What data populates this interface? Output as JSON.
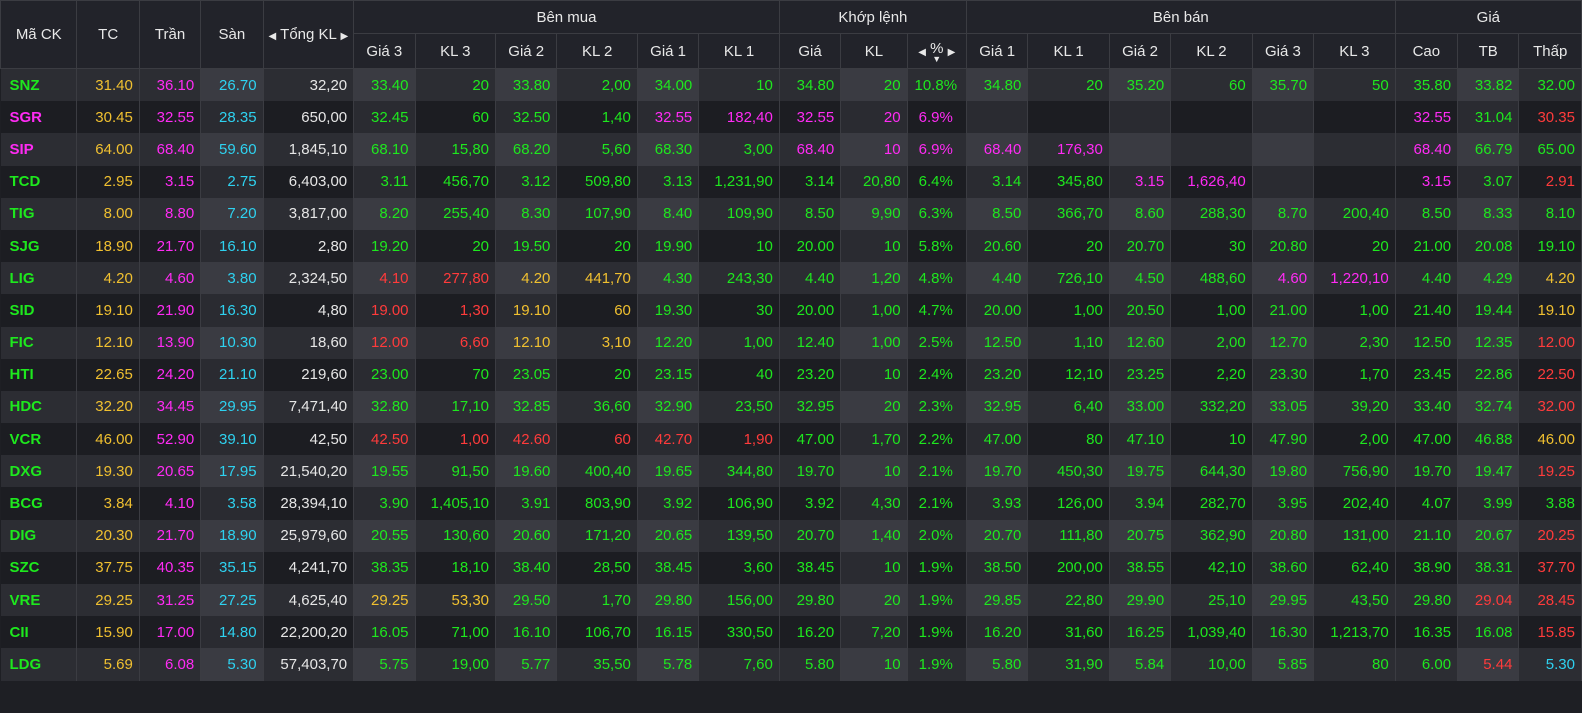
{
  "header": {
    "ma_ck": "Mã CK",
    "tc": "TC",
    "tran": "Trần",
    "san": "Sàn",
    "tong_kl": "Tổng KL",
    "ben_mua": "Bên mua",
    "khop_lenh": "Khớp lệnh",
    "ben_ban": "Bên bán",
    "gia": "Giá",
    "buy_cols": [
      "Giá 3",
      "KL 3",
      "Giá 2",
      "KL 2",
      "Giá 1",
      "KL 1"
    ],
    "match_cols": [
      "Giá",
      "KL",
      "%"
    ],
    "sell_cols": [
      "Giá 1",
      "KL 1",
      "Giá 2",
      "KL 2",
      "Giá 3",
      "KL 3"
    ],
    "price_cols": [
      "Cao",
      "TB",
      "Thấp"
    ]
  },
  "icons": {
    "left": "triangle-left-icon",
    "right": "triangle-right-icon",
    "sort": "sort-down-icon"
  },
  "colors": {
    "ceiling": "#ff2bf4",
    "floor": "#2ed2f0",
    "ref": "#f0c030",
    "up": "#1ee81e",
    "down": "#ff3b3b"
  },
  "rows": [
    {
      "sym": "SNZ",
      "c": "g",
      "v": [
        "31.40",
        "36.10",
        "26.70",
        "32,20",
        "33.40",
        "20",
        "33.80",
        "2,00",
        "34.00",
        "10",
        "34.80",
        "20",
        "10.8%",
        "34.80",
        "20",
        "35.20",
        "60",
        "35.70",
        "50",
        "35.80",
        "33.82",
        "32.00"
      ],
      "k": "yp c w g g g g g g g g g g g g g g g g g g"
    },
    {
      "sym": "SGR",
      "c": "p",
      "v": [
        "30.45",
        "32.55",
        "28.35",
        "650,00",
        "32.45",
        "60",
        "32.50",
        "1,40",
        "32.55",
        "182,40",
        "32.55",
        "20",
        "6.9%",
        "",
        "",
        "",
        "",
        "",
        "",
        "32.55",
        "31.04",
        "30.35"
      ],
      "k": "yp c w g g g g p p p p p w w w w w w p g r"
    },
    {
      "sym": "SIP",
      "c": "p",
      "v": [
        "64.00",
        "68.40",
        "59.60",
        "1,845,10",
        "68.10",
        "15,80",
        "68.20",
        "5,60",
        "68.30",
        "3,00",
        "68.40",
        "10",
        "6.9%",
        "68.40",
        "176,30",
        "",
        "",
        "",
        "",
        "68.40",
        "66.79",
        "65.00"
      ],
      "k": "yp c w g g g g g g p p p p p w w w w p g g"
    },
    {
      "sym": "TCD",
      "c": "g",
      "v": [
        "2.95",
        "3.15",
        "2.75",
        "6,403,00",
        "3.11",
        "456,70",
        "3.12",
        "509,80",
        "3.13",
        "1,231,90",
        "3.14",
        "20,80",
        "6.4%",
        "3.14",
        "345,80",
        "3.15",
        "1,626,40",
        "",
        "",
        "3.15",
        "3.07",
        "2.91"
      ],
      "k": "yp c w g g g g g g g g g g g p p w w p g r"
    },
    {
      "sym": "TIG",
      "c": "g",
      "v": [
        "8.00",
        "8.80",
        "7.20",
        "3,817,00",
        "8.20",
        "255,40",
        "8.30",
        "107,90",
        "8.40",
        "109,90",
        "8.50",
        "9,90",
        "6.3%",
        "8.50",
        "366,70",
        "8.60",
        "288,30",
        "8.70",
        "200,40",
        "8.50",
        "8.33",
        "8.10"
      ],
      "k": "yp c w g g g g g g g g g g g g g g g g g g"
    },
    {
      "sym": "SJG",
      "c": "g",
      "v": [
        "18.90",
        "21.70",
        "16.10",
        "2,80",
        "19.20",
        "20",
        "19.50",
        "20",
        "19.90",
        "10",
        "20.00",
        "10",
        "5.8%",
        "20.60",
        "20",
        "20.70",
        "30",
        "20.80",
        "20",
        "21.00",
        "20.08",
        "19.10"
      ],
      "k": "yp c w g g g g g g g g g g g g g g g g g g"
    },
    {
      "sym": "LIG",
      "c": "g",
      "v": [
        "4.20",
        "4.60",
        "3.80",
        "2,324,50",
        "4.10",
        "277,80",
        "4.20",
        "441,70",
        "4.30",
        "243,30",
        "4.40",
        "1,20",
        "4.8%",
        "4.40",
        "726,10",
        "4.50",
        "488,60",
        "4.60",
        "1,220,10",
        "4.40",
        "4.29",
        "4.20"
      ],
      "k": "yp c w r r y y g g g g g g g g g p p g g y"
    },
    {
      "sym": "SID",
      "c": "g",
      "v": [
        "19.10",
        "21.90",
        "16.30",
        "4,80",
        "19.00",
        "1,30",
        "19.10",
        "60",
        "19.30",
        "30",
        "20.00",
        "1,00",
        "4.7%",
        "20.00",
        "1,00",
        "20.50",
        "1,00",
        "21.00",
        "1,00",
        "21.40",
        "19.44",
        "19.10"
      ],
      "k": "yp c w r r y y g g g g g g g g g g g g g y"
    },
    {
      "sym": "FIC",
      "c": "g",
      "v": [
        "12.10",
        "13.90",
        "10.30",
        "18,60",
        "12.00",
        "6,60",
        "12.10",
        "3,10",
        "12.20",
        "1,00",
        "12.40",
        "1,00",
        "2.5%",
        "12.50",
        "1,10",
        "12.60",
        "2,00",
        "12.70",
        "2,30",
        "12.50",
        "12.35",
        "12.00"
      ],
      "k": "yp c w r r y y g g g g g g g g g g g g g r"
    },
    {
      "sym": "HTI",
      "c": "g",
      "v": [
        "22.65",
        "24.20",
        "21.10",
        "219,60",
        "23.00",
        "70",
        "23.05",
        "20",
        "23.15",
        "40",
        "23.20",
        "10",
        "2.4%",
        "23.20",
        "12,10",
        "23.25",
        "2,20",
        "23.30",
        "1,70",
        "23.45",
        "22.86",
        "22.50"
      ],
      "k": "yp c w g g g g g g g g g g g g g g g g g r"
    },
    {
      "sym": "HDC",
      "c": "g",
      "v": [
        "32.20",
        "34.45",
        "29.95",
        "7,471,40",
        "32.80",
        "17,10",
        "32.85",
        "36,60",
        "32.90",
        "23,50",
        "32.95",
        "20",
        "2.3%",
        "32.95",
        "6,40",
        "33.00",
        "332,20",
        "33.05",
        "39,20",
        "33.40",
        "32.74",
        "32.00"
      ],
      "k": "yp c w g g g g g g g g g g g g g g g g g r"
    },
    {
      "sym": "VCR",
      "c": "g",
      "v": [
        "46.00",
        "52.90",
        "39.10",
        "42,50",
        "42.50",
        "1,00",
        "42.60",
        "60",
        "42.70",
        "1,90",
        "47.00",
        "1,70",
        "2.2%",
        "47.00",
        "80",
        "47.10",
        "10",
        "47.90",
        "2,00",
        "47.00",
        "46.88",
        "46.00"
      ],
      "k": "yp c w r r r r r r g g g g g g g g g g g y"
    },
    {
      "sym": "DXG",
      "c": "g",
      "v": [
        "19.30",
        "20.65",
        "17.95",
        "21,540,20",
        "19.55",
        "91,50",
        "19.60",
        "400,40",
        "19.65",
        "344,80",
        "19.70",
        "10",
        "2.1%",
        "19.70",
        "450,30",
        "19.75",
        "644,30",
        "19.80",
        "756,90",
        "19.70",
        "19.47",
        "19.25"
      ],
      "k": "yp c w g g g g g g g g g g g g g g g g g r"
    },
    {
      "sym": "BCG",
      "c": "g",
      "v": [
        "3.84",
        "4.10",
        "3.58",
        "28,394,10",
        "3.90",
        "1,405,10",
        "3.91",
        "803,90",
        "3.92",
        "106,90",
        "3.92",
        "4,30",
        "2.1%",
        "3.93",
        "126,00",
        "3.94",
        "282,70",
        "3.95",
        "202,40",
        "4.07",
        "3.99",
        "3.88"
      ],
      "k": "yp c w g g g g g g g g g g g g g g g g g g"
    },
    {
      "sym": "DIG",
      "c": "g",
      "v": [
        "20.30",
        "21.70",
        "18.90",
        "25,979,60",
        "20.55",
        "130,60",
        "20.60",
        "171,20",
        "20.65",
        "139,50",
        "20.70",
        "1,40",
        "2.0%",
        "20.70",
        "111,80",
        "20.75",
        "362,90",
        "20.80",
        "131,00",
        "21.10",
        "20.67",
        "20.25"
      ],
      "k": "yp c w g g g g g g g g g g g g g g g g g r"
    },
    {
      "sym": "SZC",
      "c": "g",
      "v": [
        "37.75",
        "40.35",
        "35.15",
        "4,241,70",
        "38.35",
        "18,10",
        "38.40",
        "28,50",
        "38.45",
        "3,60",
        "38.45",
        "10",
        "1.9%",
        "38.50",
        "200,00",
        "38.55",
        "42,10",
        "38.60",
        "62,40",
        "38.90",
        "38.31",
        "37.70"
      ],
      "k": "yp c w g g g g g g g g g g g g g g g g g r"
    },
    {
      "sym": "VRE",
      "c": "g",
      "v": [
        "29.25",
        "31.25",
        "27.25",
        "4,625,40",
        "29.25",
        "53,30",
        "29.50",
        "1,70",
        "29.80",
        "156,00",
        "29.80",
        "20",
        "1.9%",
        "29.85",
        "22,80",
        "29.90",
        "25,10",
        "29.95",
        "43,50",
        "29.80",
        "29.04",
        "28.45"
      ],
      "k": "yp c w y y g g g g g g g g g g g g g g r r"
    },
    {
      "sym": "CII",
      "c": "g",
      "v": [
        "15.90",
        "17.00",
        "14.80",
        "22,200,20",
        "16.05",
        "71,00",
        "16.10",
        "106,70",
        "16.15",
        "330,50",
        "16.20",
        "7,20",
        "1.9%",
        "16.20",
        "31,60",
        "16.25",
        "1,039,40",
        "16.30",
        "1,213,70",
        "16.35",
        "16.08",
        "15.85"
      ],
      "k": "yp c w g g g g g g g g g g g g g g g g g r"
    },
    {
      "sym": "LDG",
      "c": "g",
      "v": [
        "5.69",
        "6.08",
        "5.30",
        "57,403,70",
        "5.75",
        "19,00",
        "5.77",
        "35,50",
        "5.78",
        "7,60",
        "5.80",
        "10",
        "1.9%",
        "5.80",
        "31,90",
        "5.84",
        "10,00",
        "5.85",
        "80",
        "6.00",
        "5.44",
        "5.30"
      ],
      "k": "yp c w g g g g g g g g g g g g g g g g r c"
    }
  ]
}
